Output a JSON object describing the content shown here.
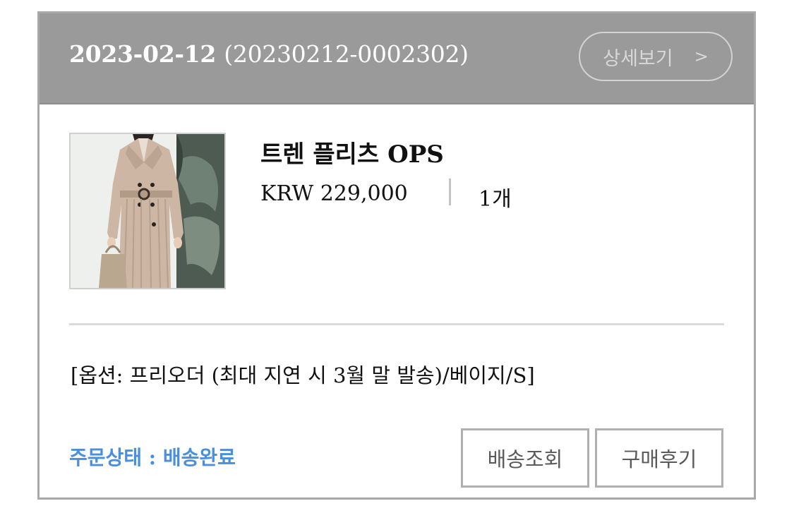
{
  "order": {
    "date": "2023-02-12",
    "number": "(20230212-0002302)",
    "detail_label": "상세보기",
    "detail_chevron": ">"
  },
  "product": {
    "image_icon": "product-photo",
    "name": "트렌 플리츠 OPS",
    "price": "KRW 229,000",
    "quantity": "1개",
    "options": "[옵션: 프리오더 (최대 지연 시 3월 말 발송)/베이지/S]"
  },
  "status": {
    "text": "주문상태 : 배송완료",
    "color": "#4a8fde"
  },
  "actions": {
    "track_label": "배송조회",
    "review_label": "구매후기"
  },
  "colors": {
    "header_bg": "#9a9a9a",
    "border": "#a9a9a9"
  }
}
